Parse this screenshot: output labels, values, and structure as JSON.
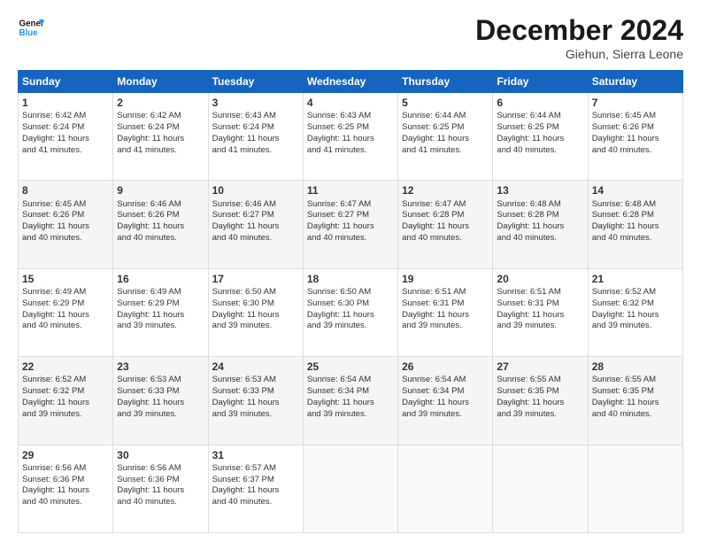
{
  "logo": {
    "text_general": "General",
    "text_blue": "Blue"
  },
  "header": {
    "title": "December 2024",
    "location": "Giehun, Sierra Leone"
  },
  "days_of_week": [
    "Sunday",
    "Monday",
    "Tuesday",
    "Wednesday",
    "Thursday",
    "Friday",
    "Saturday"
  ],
  "weeks": [
    [
      {
        "day": "1",
        "lines": [
          "Sunrise: 6:42 AM",
          "Sunset: 6:24 PM",
          "Daylight: 11 hours",
          "and 41 minutes."
        ]
      },
      {
        "day": "2",
        "lines": [
          "Sunrise: 6:42 AM",
          "Sunset: 6:24 PM",
          "Daylight: 11 hours",
          "and 41 minutes."
        ]
      },
      {
        "day": "3",
        "lines": [
          "Sunrise: 6:43 AM",
          "Sunset: 6:24 PM",
          "Daylight: 11 hours",
          "and 41 minutes."
        ]
      },
      {
        "day": "4",
        "lines": [
          "Sunrise: 6:43 AM",
          "Sunset: 6:25 PM",
          "Daylight: 11 hours",
          "and 41 minutes."
        ]
      },
      {
        "day": "5",
        "lines": [
          "Sunrise: 6:44 AM",
          "Sunset: 6:25 PM",
          "Daylight: 11 hours",
          "and 41 minutes."
        ]
      },
      {
        "day": "6",
        "lines": [
          "Sunrise: 6:44 AM",
          "Sunset: 6:25 PM",
          "Daylight: 11 hours",
          "and 40 minutes."
        ]
      },
      {
        "day": "7",
        "lines": [
          "Sunrise: 6:45 AM",
          "Sunset: 6:26 PM",
          "Daylight: 11 hours",
          "and 40 minutes."
        ]
      }
    ],
    [
      {
        "day": "8",
        "lines": [
          "Sunrise: 6:45 AM",
          "Sunset: 6:26 PM",
          "Daylight: 11 hours",
          "and 40 minutes."
        ]
      },
      {
        "day": "9",
        "lines": [
          "Sunrise: 6:46 AM",
          "Sunset: 6:26 PM",
          "Daylight: 11 hours",
          "and 40 minutes."
        ]
      },
      {
        "day": "10",
        "lines": [
          "Sunrise: 6:46 AM",
          "Sunset: 6:27 PM",
          "Daylight: 11 hours",
          "and 40 minutes."
        ]
      },
      {
        "day": "11",
        "lines": [
          "Sunrise: 6:47 AM",
          "Sunset: 6:27 PM",
          "Daylight: 11 hours",
          "and 40 minutes."
        ]
      },
      {
        "day": "12",
        "lines": [
          "Sunrise: 6:47 AM",
          "Sunset: 6:28 PM",
          "Daylight: 11 hours",
          "and 40 minutes."
        ]
      },
      {
        "day": "13",
        "lines": [
          "Sunrise: 6:48 AM",
          "Sunset: 6:28 PM",
          "Daylight: 11 hours",
          "and 40 minutes."
        ]
      },
      {
        "day": "14",
        "lines": [
          "Sunrise: 6:48 AM",
          "Sunset: 6:28 PM",
          "Daylight: 11 hours",
          "and 40 minutes."
        ]
      }
    ],
    [
      {
        "day": "15",
        "lines": [
          "Sunrise: 6:49 AM",
          "Sunset: 6:29 PM",
          "Daylight: 11 hours",
          "and 40 minutes."
        ]
      },
      {
        "day": "16",
        "lines": [
          "Sunrise: 6:49 AM",
          "Sunset: 6:29 PM",
          "Daylight: 11 hours",
          "and 39 minutes."
        ]
      },
      {
        "day": "17",
        "lines": [
          "Sunrise: 6:50 AM",
          "Sunset: 6:30 PM",
          "Daylight: 11 hours",
          "and 39 minutes."
        ]
      },
      {
        "day": "18",
        "lines": [
          "Sunrise: 6:50 AM",
          "Sunset: 6:30 PM",
          "Daylight: 11 hours",
          "and 39 minutes."
        ]
      },
      {
        "day": "19",
        "lines": [
          "Sunrise: 6:51 AM",
          "Sunset: 6:31 PM",
          "Daylight: 11 hours",
          "and 39 minutes."
        ]
      },
      {
        "day": "20",
        "lines": [
          "Sunrise: 6:51 AM",
          "Sunset: 6:31 PM",
          "Daylight: 11 hours",
          "and 39 minutes."
        ]
      },
      {
        "day": "21",
        "lines": [
          "Sunrise: 6:52 AM",
          "Sunset: 6:32 PM",
          "Daylight: 11 hours",
          "and 39 minutes."
        ]
      }
    ],
    [
      {
        "day": "22",
        "lines": [
          "Sunrise: 6:52 AM",
          "Sunset: 6:32 PM",
          "Daylight: 11 hours",
          "and 39 minutes."
        ]
      },
      {
        "day": "23",
        "lines": [
          "Sunrise: 6:53 AM",
          "Sunset: 6:33 PM",
          "Daylight: 11 hours",
          "and 39 minutes."
        ]
      },
      {
        "day": "24",
        "lines": [
          "Sunrise: 6:53 AM",
          "Sunset: 6:33 PM",
          "Daylight: 11 hours",
          "and 39 minutes."
        ]
      },
      {
        "day": "25",
        "lines": [
          "Sunrise: 6:54 AM",
          "Sunset: 6:34 PM",
          "Daylight: 11 hours",
          "and 39 minutes."
        ]
      },
      {
        "day": "26",
        "lines": [
          "Sunrise: 6:54 AM",
          "Sunset: 6:34 PM",
          "Daylight: 11 hours",
          "and 39 minutes."
        ]
      },
      {
        "day": "27",
        "lines": [
          "Sunrise: 6:55 AM",
          "Sunset: 6:35 PM",
          "Daylight: 11 hours",
          "and 39 minutes."
        ]
      },
      {
        "day": "28",
        "lines": [
          "Sunrise: 6:55 AM",
          "Sunset: 6:35 PM",
          "Daylight: 11 hours",
          "and 40 minutes."
        ]
      }
    ],
    [
      {
        "day": "29",
        "lines": [
          "Sunrise: 6:56 AM",
          "Sunset: 6:36 PM",
          "Daylight: 11 hours",
          "and 40 minutes."
        ]
      },
      {
        "day": "30",
        "lines": [
          "Sunrise: 6:56 AM",
          "Sunset: 6:36 PM",
          "Daylight: 11 hours",
          "and 40 minutes."
        ]
      },
      {
        "day": "31",
        "lines": [
          "Sunrise: 6:57 AM",
          "Sunset: 6:37 PM",
          "Daylight: 11 hours",
          "and 40 minutes."
        ]
      },
      null,
      null,
      null,
      null
    ]
  ]
}
